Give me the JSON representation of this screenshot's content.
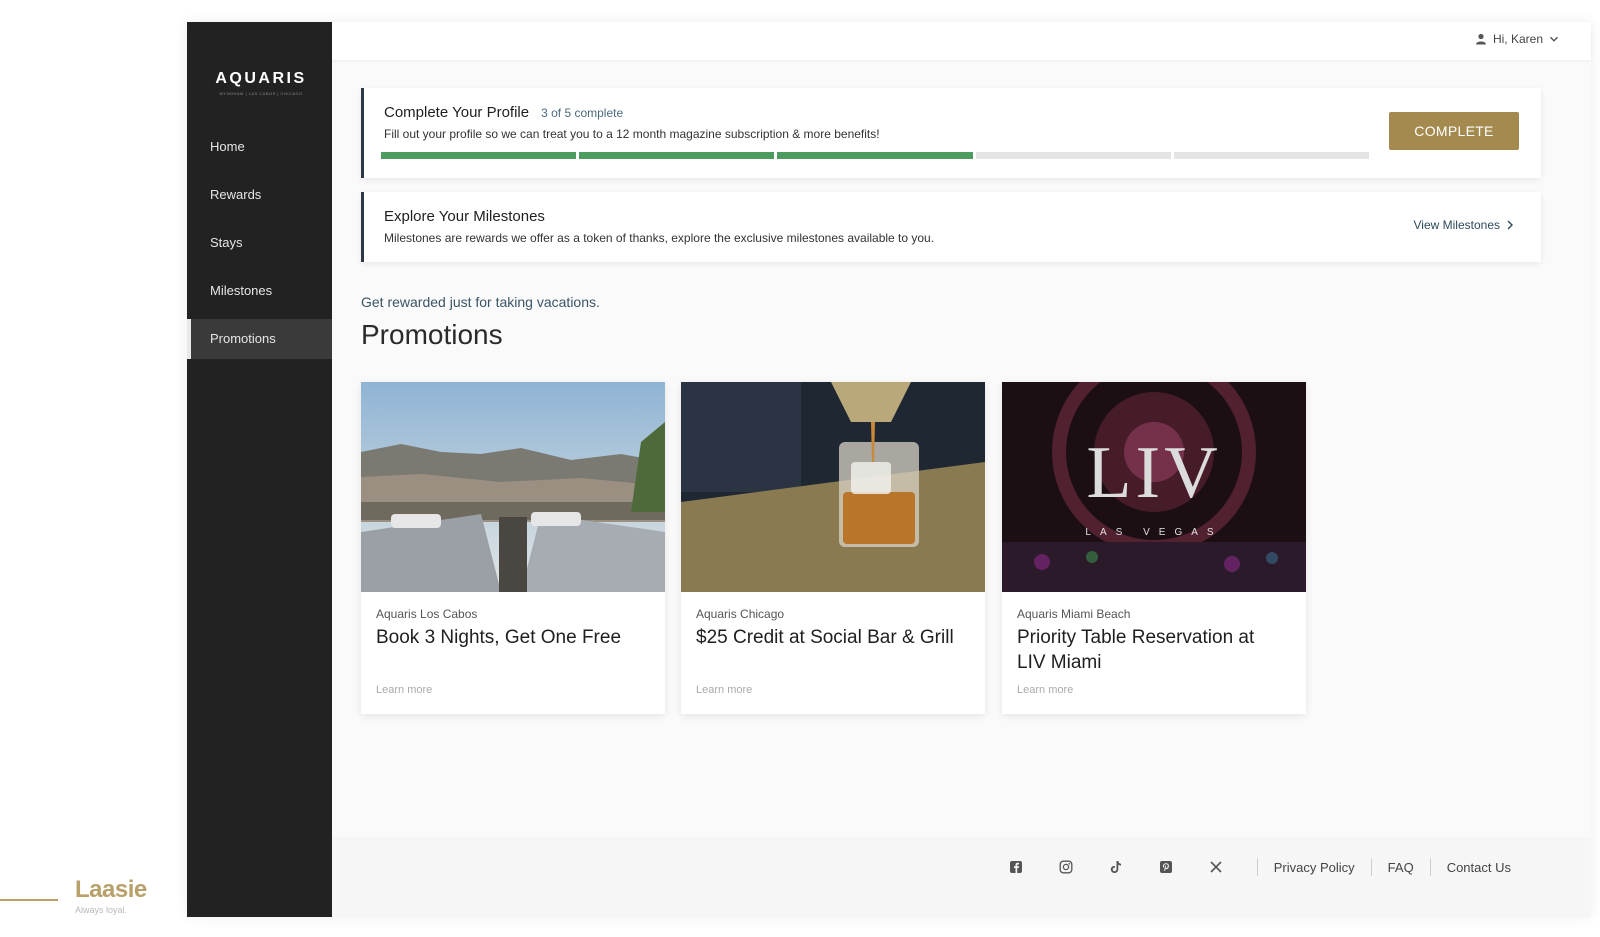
{
  "brand": {
    "name": "Laasie",
    "tagline": "Always loyal.",
    "color": "#b8a06a"
  },
  "app": {
    "logo": {
      "title": "AQUARIS",
      "subtitle": "WYNDHAM | LAS CABOS | CHICAGO"
    },
    "sidebar": {
      "items": [
        {
          "label": "Home"
        },
        {
          "label": "Rewards"
        },
        {
          "label": "Stays"
        },
        {
          "label": "Milestones"
        },
        {
          "label": "Promotions",
          "active": true
        }
      ]
    },
    "header": {
      "greeting": "Hi, Karen",
      "user_icon": "user-icon",
      "menu_icon": "chevron-down-icon"
    },
    "profile_card": {
      "title": "Complete Your Profile",
      "status": "3 of 5 complete",
      "description": "Fill out your profile so we can treat you to a 12 month magazine subscription & more benefits!",
      "progress": {
        "completed": 3,
        "total": 5
      },
      "button_label": "COMPLETE"
    },
    "milestones_card": {
      "title": "Explore Your Milestones",
      "description": "Milestones are rewards we offer as a token of thanks, explore the exclusive milestones available to you.",
      "link_label": "View Milestones"
    },
    "promotions": {
      "subtitle": "Get rewarded just for taking vacations.",
      "title": "Promotions",
      "items": [
        {
          "location": "Aquaris Los Cabos",
          "title": "Book 3 Nights, Get One Free",
          "link": "Learn more"
        },
        {
          "location": "Aquaris Chicago",
          "title": "$25 Credit at Social Bar & Grill",
          "link": "Learn more"
        },
        {
          "location": "Aquaris Miami Beach",
          "title": "Priority Table Reservation at LIV Miami",
          "link": "Learn more",
          "image_text": {
            "logo": "LIV",
            "sub": "LAS VEGAS"
          }
        }
      ]
    },
    "footer": {
      "social_icons": [
        "facebook-icon",
        "instagram-icon",
        "tiktok-icon",
        "pinterest-icon",
        "x-icon"
      ],
      "links": [
        "Privacy Policy",
        "FAQ",
        "Contact Us"
      ]
    },
    "colors": {
      "accent": "#a48a4e",
      "progress": "#4c9b5f",
      "sidebar": "#222222"
    }
  }
}
